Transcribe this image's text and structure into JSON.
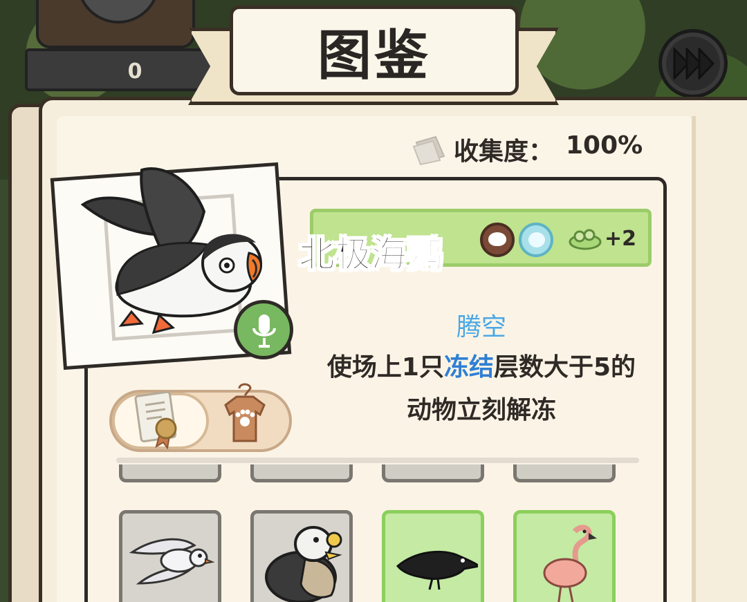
{
  "header": {
    "title": "图鉴",
    "counter_value": "0"
  },
  "collection": {
    "label": "收集度：",
    "value": "100%"
  },
  "animal": {
    "name": "北极海鹦",
    "bonus_count": "+2",
    "skill": {
      "name": "腾空",
      "desc_part1": "使场上1只",
      "desc_keyword": "冻结",
      "desc_part2": "层数大于5的",
      "desc_line2": "动物立刻解冻"
    }
  },
  "icons": {
    "fast_forward": "fast-forward-icon",
    "collection": "book-icon",
    "voice": "microphone-icon",
    "certificate": "certificate-icon",
    "outfit": "shirt-paw-icon",
    "bonus": "sprout-food-icon"
  },
  "grid": {
    "tiles": [
      {
        "animal": "seagull",
        "unlocked": false
      },
      {
        "animal": "eider-duck",
        "unlocked": false
      },
      {
        "animal": "crow",
        "unlocked": true
      },
      {
        "animal": "flamingo",
        "unlocked": true
      }
    ]
  },
  "colors": {
    "name_bar": "#bfe38e",
    "skill_name": "#49a7e6",
    "skill_keyword": "#2f7fd4",
    "voice_button": "#78b860",
    "unlocked_tile": "#c4eaa4",
    "locked_tile": "#d7d4cd"
  }
}
